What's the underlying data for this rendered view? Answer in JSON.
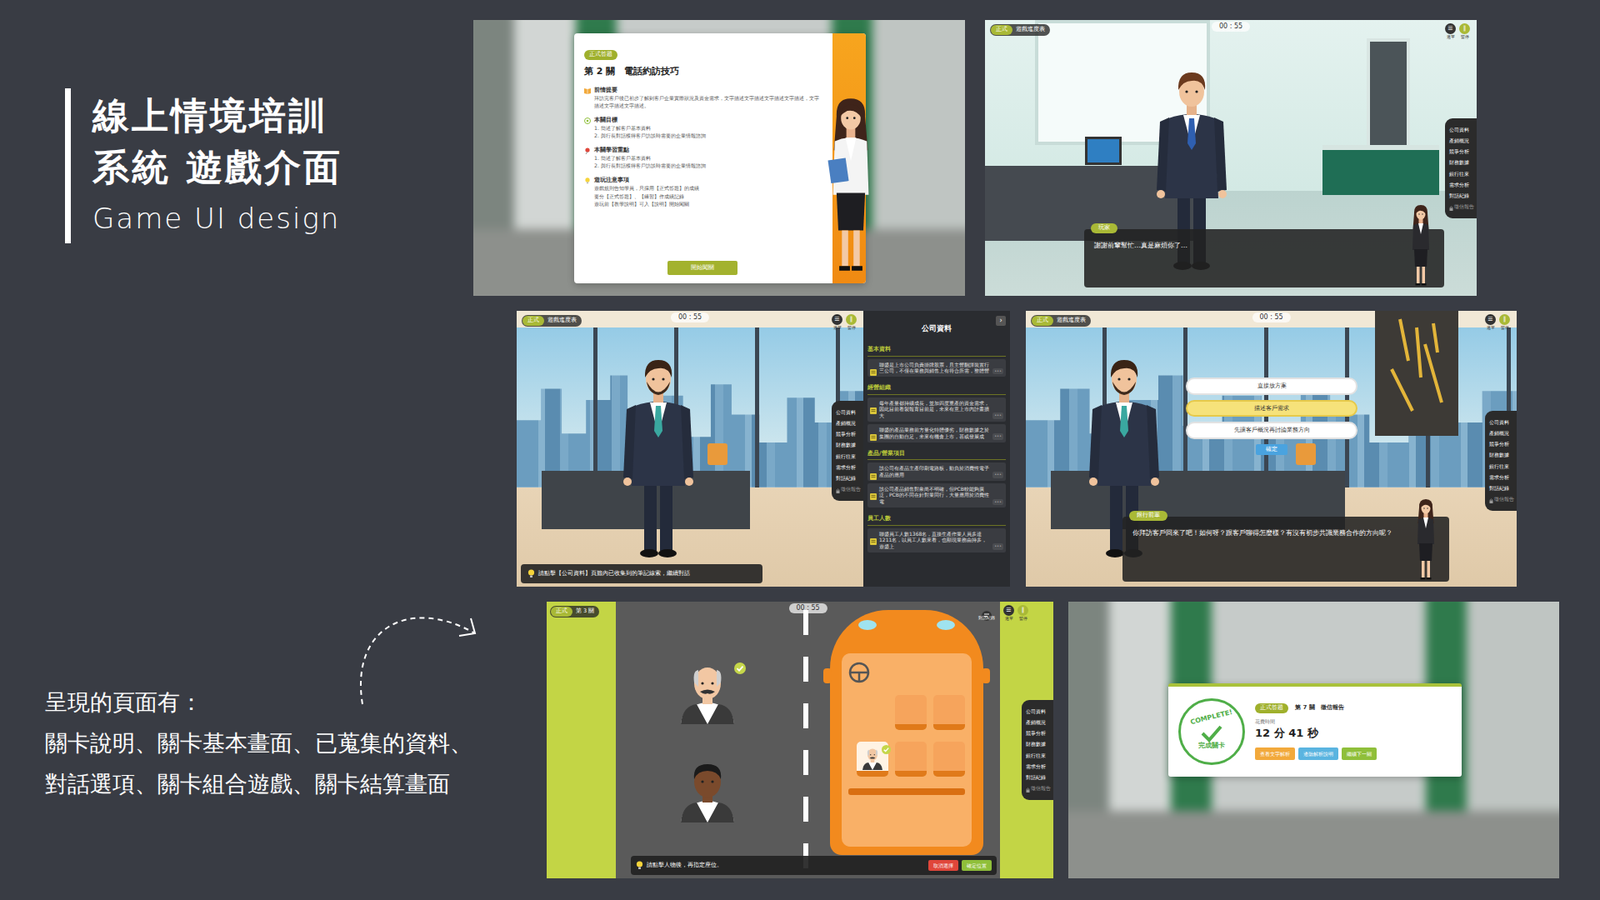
{
  "slide": {
    "title_lines": [
      "線上情境培訓",
      "系統 遊戲介面"
    ],
    "subtitle": "Game UI design",
    "summary": {
      "heading": "呈現的頁面有：",
      "lines": [
        "關卡說明、關卡基本畫面、已蒐集的資料、",
        "對話選項、關卡組合遊戲、關卡結算畫面"
      ]
    }
  },
  "hud": {
    "mode_badge": "正式",
    "progress_label": "遊戲進度表",
    "timer": "00 : 55",
    "menu_icon": "☰",
    "menu_label": "選單",
    "pause_icon": "∥",
    "pause_label": "暫停"
  },
  "sidebar": {
    "items": [
      {
        "label": "公司資料",
        "locked": false
      },
      {
        "label": "產銷概況",
        "locked": false
      },
      {
        "label": "競爭分析",
        "locked": false
      },
      {
        "label": "財務數據",
        "locked": false
      },
      {
        "label": "銀行往來",
        "locked": false
      },
      {
        "label": "需求分析",
        "locked": false
      },
      {
        "label": "對話紀錄",
        "locked": false
      },
      {
        "label": "徵信報告",
        "locked": true
      }
    ]
  },
  "intro": {
    "badge": "正式答題",
    "title": "第 2 關　電話約訪技巧",
    "sections": [
      {
        "heading": "前情提要",
        "lines": [
          "拜訪完客戶後已初步了解到客戶企業實際狀況及資金需求，文字描述文字描述文字描述文字描述，文字描述文字描述文字描述。"
        ]
      },
      {
        "heading": "本關目標",
        "lines": [
          "1. 簡述了解客戶基本資料",
          "2. 與行長對話獲得客戶訪談時需要的企業情報諮詢"
        ]
      },
      {
        "heading": "本關學習重點",
        "lines": [
          "1. 簡述了解客戶基本資料",
          "2. 與行長對話獲得客戶訪談時需要的企業情報諮詢"
        ]
      },
      {
        "heading": "遊玩注意事項",
        "lines": [
          "遊戲規則告知學員，只採用【正式答題】的成績",
          "要分【正式答題】、【練習】作成績記錄",
          "遊玩前【教學說明】可入【說明】開始闖關"
        ]
      }
    ],
    "start_button": "開始闖關"
  },
  "scene_greeting": {
    "speaker": "玩家",
    "line": "謝謝前輩幫忙…真是麻煩你了…"
  },
  "scene_hint": {
    "hint": "請點擊【公司資料】頁籤內已收集到的筆記線索，繼續對話"
  },
  "company_panel": {
    "title": "公司資料",
    "close_icon": "›",
    "more": "•••",
    "sections": [
      {
        "heading": "基本資料",
        "notes": [
          "聯盛是上市公司負責掛牌股票，且主營翻譯裝置行三公司，不僅在業務與銷售上有符合所需，整體營"
        ]
      },
      {
        "heading": "經營組織",
        "notes": [
          "每年產量都持續成長，並加四度重產的資金需求，因此目前看製報育目前是，未來有意上市內計畫擴大",
          "聯盛的產品業務前方量化特體優劣，財務數據之於集團的自動自足，未來有機會上市，甚或發展成"
        ]
      },
      {
        "heading": "產品/營業項目",
        "notes": [
          "該公司有產品主產印刷電路板，動負於消費性電子產品的應用",
          "該公司產品銷售對象尚不明確，但PCB較能夠廣泛，PCB的不同在針對業同行，大量應用於消費性電"
        ]
      },
      {
        "heading": "員工人數",
        "notes": [
          "聯盛員工人數1368名，直接生產作業人員多達1211名，以員工人數來看，也顯現業務由持多，遊盛上"
        ]
      }
    ]
  },
  "scene_choice": {
    "options": [
      {
        "label": "直接放方案",
        "selected": false
      },
      {
        "label": "描述客戶需求",
        "selected": true
      },
      {
        "label": "先讓客戶概況再討論業務方向",
        "selected": false
      }
    ],
    "confirm": "確定",
    "speaker": "銀行前輩",
    "line": "你拜訪客戶回來了吧！如何呀？跟客戶聊得怎麼樣？有沒有初步共識業務合作的方向呢？"
  },
  "bus_game": {
    "level_badge": "第 3 關",
    "dialog_log": "對話紀錄",
    "passengers": [
      {
        "placed": true
      },
      {
        "placed": false
      }
    ],
    "seat_rows": [
      [
        {
          "occupied": false
        },
        {
          "occupied": false
        }
      ],
      [
        {
          "occupied": true
        },
        {
          "occupied": false
        },
        {
          "occupied": false
        }
      ]
    ],
    "hint": "請點擊人物後，再指定座位。",
    "cancel": "取消選擇",
    "confirm": "確定位置"
  },
  "result": {
    "stamp_top": "COMPLETE!",
    "stamp_bottom": "完成關卡",
    "badge": "正式答題",
    "level": "第 7 關　徵信報告",
    "time_label": "花費時間",
    "time": "12 分 41 秒",
    "buttons": [
      "查看文字解析",
      "邊聽解析說明",
      "繼續下一關"
    ]
  }
}
